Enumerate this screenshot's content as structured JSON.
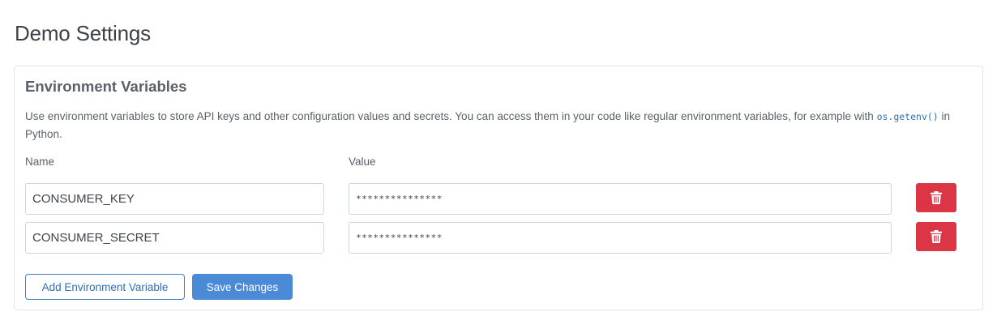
{
  "page": {
    "title": "Demo Settings"
  },
  "env_card": {
    "title": "Environment Variables",
    "description_prefix": "Use environment variables to store API keys and other configuration values and secrets. You can access them in your code like regular environment variables, for example with ",
    "description_code": "os.getenv()",
    "description_suffix": " in Python.",
    "name_header": "Name",
    "value_header": "Value",
    "rows": [
      {
        "name": "CONSUMER_KEY",
        "value": "***************"
      },
      {
        "name": "CONSUMER_SECRET",
        "value": "***************"
      }
    ],
    "delete_icon": "trash-icon",
    "add_button_label": "Add Environment Variable",
    "save_button_label": "Save Changes"
  },
  "colors": {
    "danger": "#dc3545",
    "primary": "#4a8ad6",
    "link": "#2f6fb3"
  }
}
